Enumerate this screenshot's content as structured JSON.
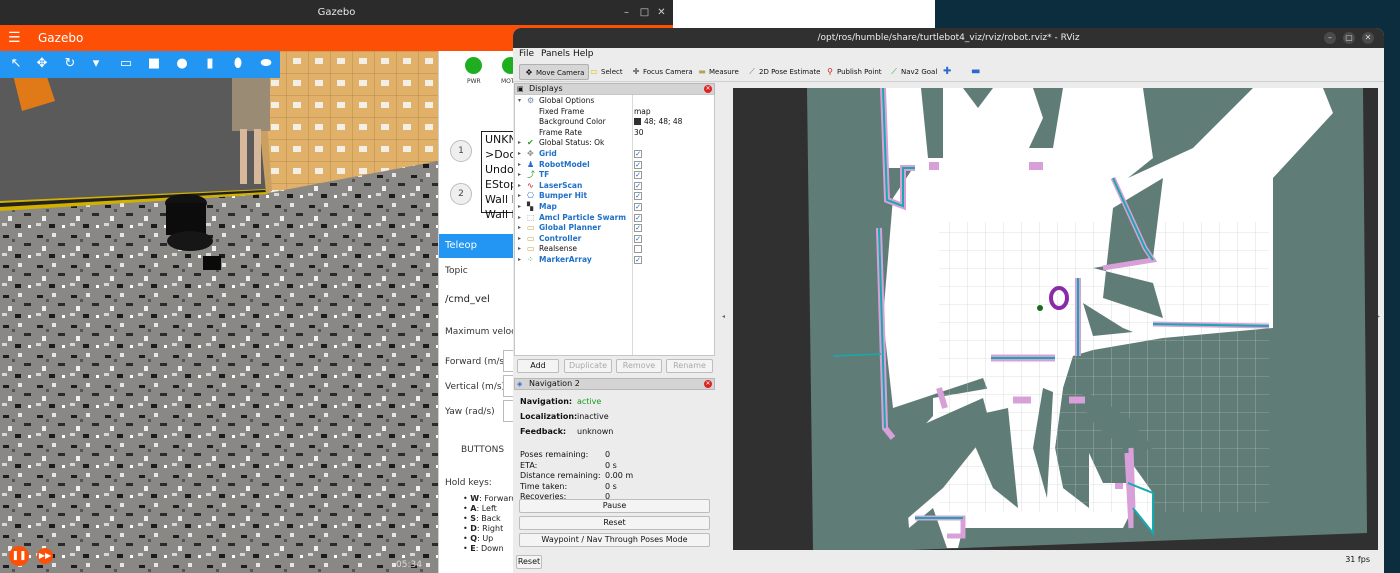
{
  "gazebo": {
    "window_title": "Gazebo",
    "app_title": "Gazebo",
    "status_leds": [
      {
        "label": "PWR",
        "color": "#1fae1f"
      },
      {
        "label": "MOT",
        "color": "#1fae1f"
      }
    ],
    "steps": [
      "1",
      "2"
    ],
    "dock_status_list": [
      "UNKN",
      ">Dock",
      "Undo",
      "EStop",
      "Wall F",
      "Wall F"
    ],
    "teleop": {
      "title": "Teleop",
      "topic_label": "Topic",
      "topic_value": "/cmd_vel",
      "max_velocity_label": "Maximum velocity",
      "forward_label": "Forward (m/s)",
      "vertical_label": "Vertical (m/s)",
      "yaw_label": "Yaw (rad/s)",
      "buttons_label": "BUTTONS",
      "hold_keys_label": "Hold keys:",
      "hold_keys": [
        {
          "key": "W",
          "action": ": Forward"
        },
        {
          "key": "A",
          "action": ": Left"
        },
        {
          "key": "S",
          "action": ": Back"
        },
        {
          "key": "D",
          "action": ": Right"
        },
        {
          "key": "Q",
          "action": ": Up"
        },
        {
          "key": "E",
          "action": ": Down"
        }
      ]
    },
    "sim_time": "05:34",
    "accent_color": "#fd4f06",
    "toolbar_color": "#2296f2"
  },
  "rviz": {
    "window_title": "/opt/ros/humble/share/turtlebot4_viz/rviz/robot.rviz* - RViz",
    "menu": [
      "File",
      "Panels",
      "Help"
    ],
    "tools": [
      {
        "icon": "move-camera-icon",
        "label": "Move Camera"
      },
      {
        "icon": "select-icon",
        "label": "Select"
      },
      {
        "icon": "focus-camera-icon",
        "label": "Focus Camera"
      },
      {
        "icon": "measure-icon",
        "label": "Measure"
      },
      {
        "icon": "pose-estimate-icon",
        "label": "2D Pose Estimate"
      },
      {
        "icon": "publish-point-icon",
        "label": "Publish Point"
      },
      {
        "icon": "nav2-goal-icon",
        "label": "Nav2 Goal"
      }
    ],
    "displays_title": "Displays",
    "global_options": {
      "label": "Global Options",
      "fixed_frame_label": "Fixed Frame",
      "fixed_frame_value": "map",
      "background_color_label": "Background Color",
      "background_color_value": "48; 48; 48",
      "frame_rate_label": "Frame Rate",
      "frame_rate_value": "30"
    },
    "global_status": "Global Status: Ok",
    "displays": [
      {
        "label": "Grid",
        "checked": true
      },
      {
        "label": "RobotModel",
        "checked": true
      },
      {
        "label": "TF",
        "checked": true
      },
      {
        "label": "LaserScan",
        "checked": true
      },
      {
        "label": "Bumper Hit",
        "checked": true
      },
      {
        "label": "Map",
        "checked": true
      },
      {
        "label": "Amcl Particle Swarm",
        "checked": true
      },
      {
        "label": "Global Planner",
        "checked": true
      },
      {
        "label": "Controller",
        "checked": true
      },
      {
        "label": "Realsense",
        "checked": false
      },
      {
        "label": "MarkerArray",
        "checked": true
      }
    ],
    "display_buttons": [
      "Add",
      "Duplicate",
      "Remove",
      "Rename"
    ],
    "navigation": {
      "title": "Navigation 2",
      "navigation_label": "Navigation:",
      "navigation_value": "active",
      "localization_label": "Localization:",
      "localization_value": "inactive",
      "feedback_label": "Feedback:",
      "feedback_value": "unknown",
      "stats": [
        {
          "label": "Poses remaining:",
          "value": "0"
        },
        {
          "label": "ETA:",
          "value": "0 s"
        },
        {
          "label": "Distance remaining:",
          "value": "0.00 m"
        },
        {
          "label": "Time taken:",
          "value": "0 s"
        },
        {
          "label": "Recoveries:",
          "value": "0"
        }
      ],
      "pause_label": "Pause",
      "reset_label": "Reset",
      "waypoint_label": "Waypoint / Nav Through Poses Mode"
    },
    "reset_label": "Reset",
    "fps": "31 fps"
  }
}
